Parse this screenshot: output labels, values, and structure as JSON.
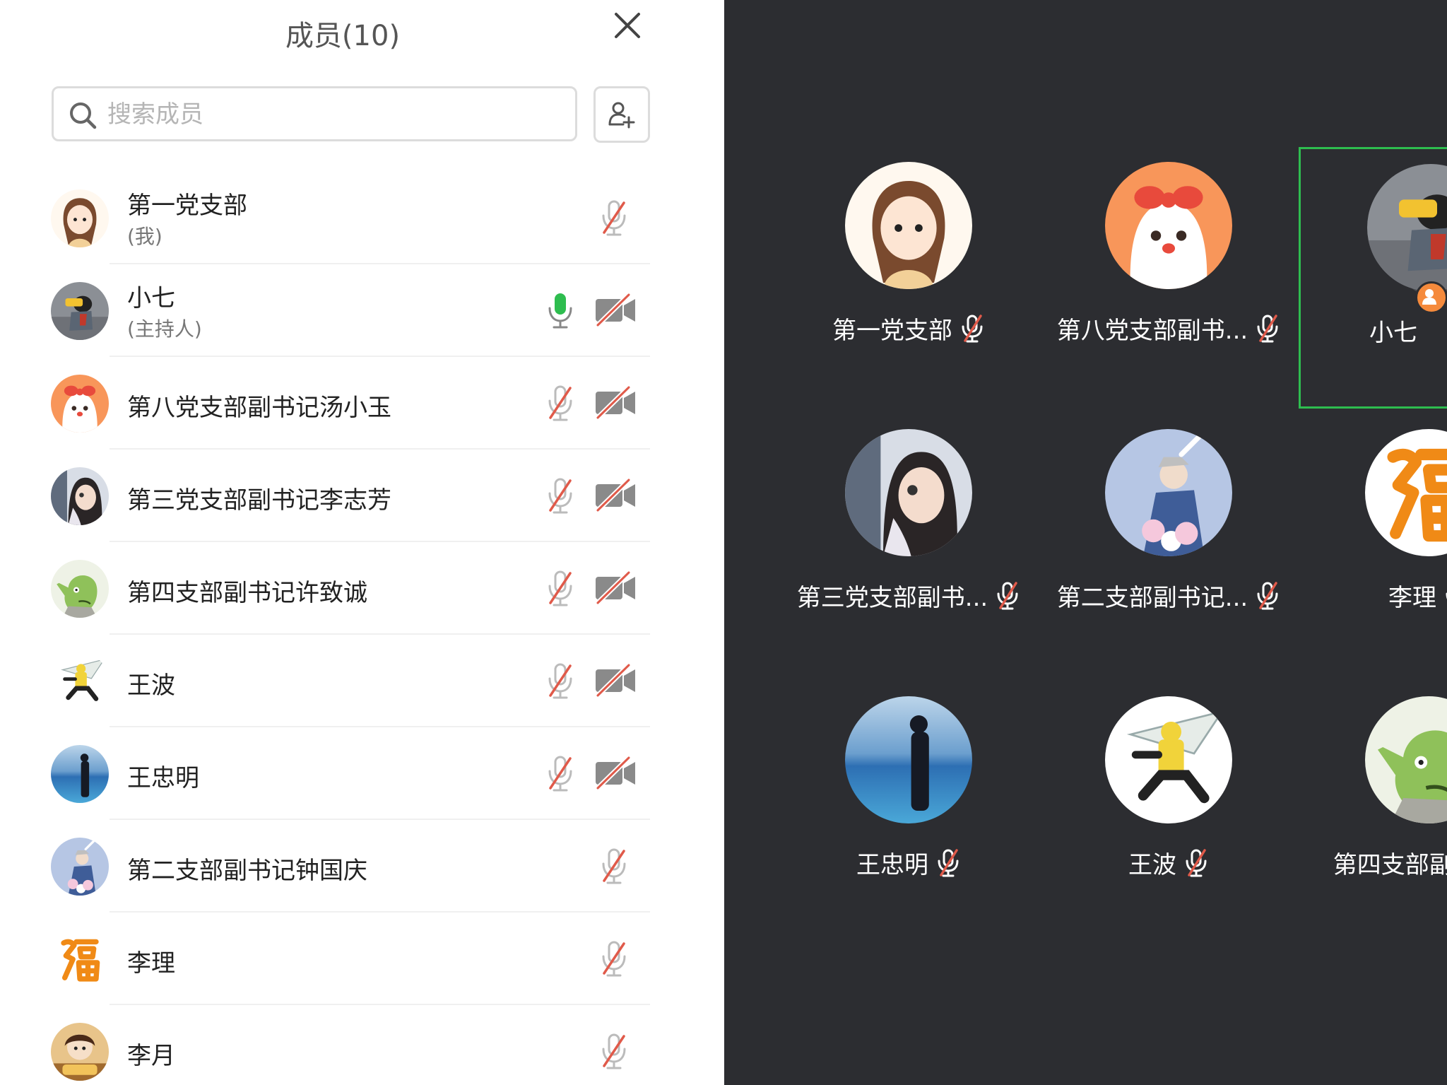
{
  "panel": {
    "title": "成员(10)",
    "search_placeholder": "搜索成员"
  },
  "colors": {
    "accent_green": "#2ebd4f",
    "mute_red": "#e05a4a",
    "grid_bg": "#2c2d31",
    "host_badge": "#f58a3c"
  },
  "members": [
    {
      "name": "第一党支部",
      "role": "(我)",
      "mic": "muted",
      "camera": "none"
    },
    {
      "name": "小七",
      "role": "(主持人)",
      "mic": "on",
      "camera": "off"
    },
    {
      "name": "第八党支部副书记汤小玉",
      "role": "",
      "mic": "muted",
      "camera": "off"
    },
    {
      "name": "第三党支部副书记李志芳",
      "role": "",
      "mic": "muted",
      "camera": "off"
    },
    {
      "name": "第四支部副书记许致诚",
      "role": "",
      "mic": "muted",
      "camera": "off"
    },
    {
      "name": "王波",
      "role": "",
      "mic": "muted",
      "camera": "off"
    },
    {
      "name": "王忠明",
      "role": "",
      "mic": "muted",
      "camera": "off"
    },
    {
      "name": "第二支部副书记钟国庆",
      "role": "",
      "mic": "muted",
      "camera": "none"
    },
    {
      "name": "李理",
      "role": "",
      "mic": "muted",
      "camera": "none"
    },
    {
      "name": "李月",
      "role": "",
      "mic": "muted",
      "camera": "none"
    }
  ],
  "tiles": [
    {
      "name": "第一党支部",
      "mic": "muted"
    },
    {
      "name": "第八党支部副书...",
      "mic": "muted"
    },
    {
      "name": "小七",
      "mic": "on"
    },
    {
      "name": "第三党支部副书...",
      "mic": "muted"
    },
    {
      "name": "第二支部副书记...",
      "mic": "muted"
    },
    {
      "name": "李理",
      "mic": "muted"
    },
    {
      "name": "王忠明",
      "mic": "muted"
    },
    {
      "name": "王波",
      "mic": "muted"
    },
    {
      "name": "第四支部副书记...",
      "mic": "none"
    }
  ]
}
